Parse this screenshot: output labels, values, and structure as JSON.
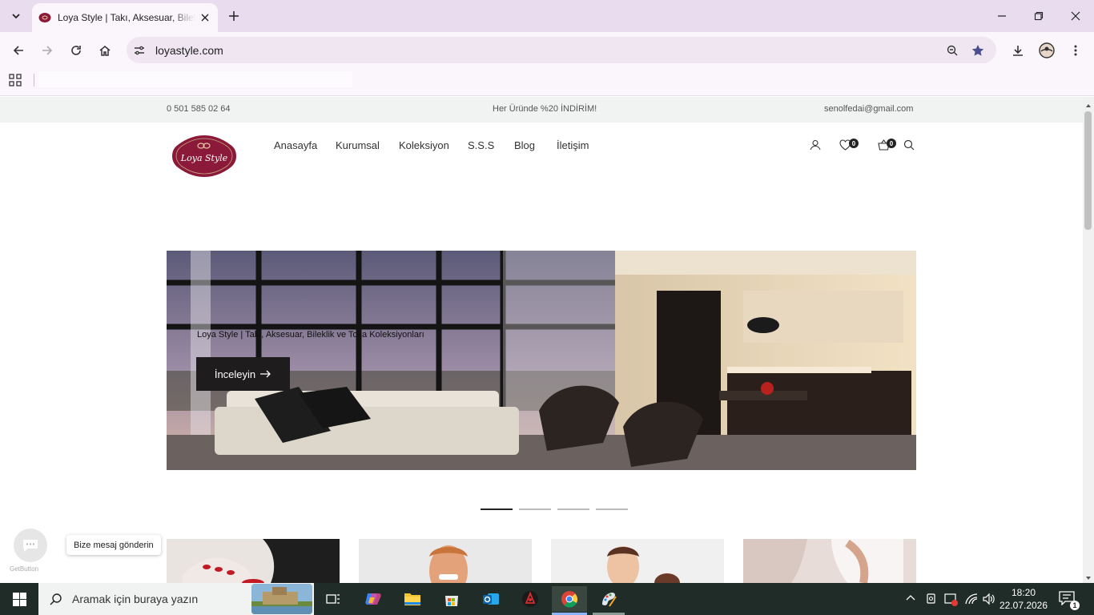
{
  "browser": {
    "tab_title": "Loya Style | Takı, Aksesuar, Bileklik ve Toka Koleksiyonları",
    "url": "loyastyle.com"
  },
  "topbar": {
    "phone": "0 501 585 02 64",
    "promo": "Her Üründe %20 İNDİRİM!",
    "email": "senolfedai@gmail.com"
  },
  "header": {
    "logo_text": "Loya Style",
    "nav": [
      "Anasayfa",
      "Kurumsal",
      "Koleksiyon",
      "S.S.S",
      "Blog",
      "İletişim"
    ],
    "wishlist_count": "0",
    "cart_count": "0"
  },
  "hero": {
    "caption": "Loya Style | Takı, Aksesuar, Bileklik ve Toka Koleksiyonları",
    "button_label": "İnceleyin",
    "slide_count": 4,
    "active_slide": 1
  },
  "chat_widget": {
    "label": "Bize mesaj gönderin",
    "brand": "GetButton"
  },
  "taskbar": {
    "search_placeholder": "Aramak için buraya yazın",
    "time": "18:20",
    "date": "22.07.2026",
    "notification_count": "1"
  },
  "colors": {
    "brand": "#8b1a3a",
    "tabstrip": "#e9dcef",
    "taskbar": "#202c27"
  }
}
